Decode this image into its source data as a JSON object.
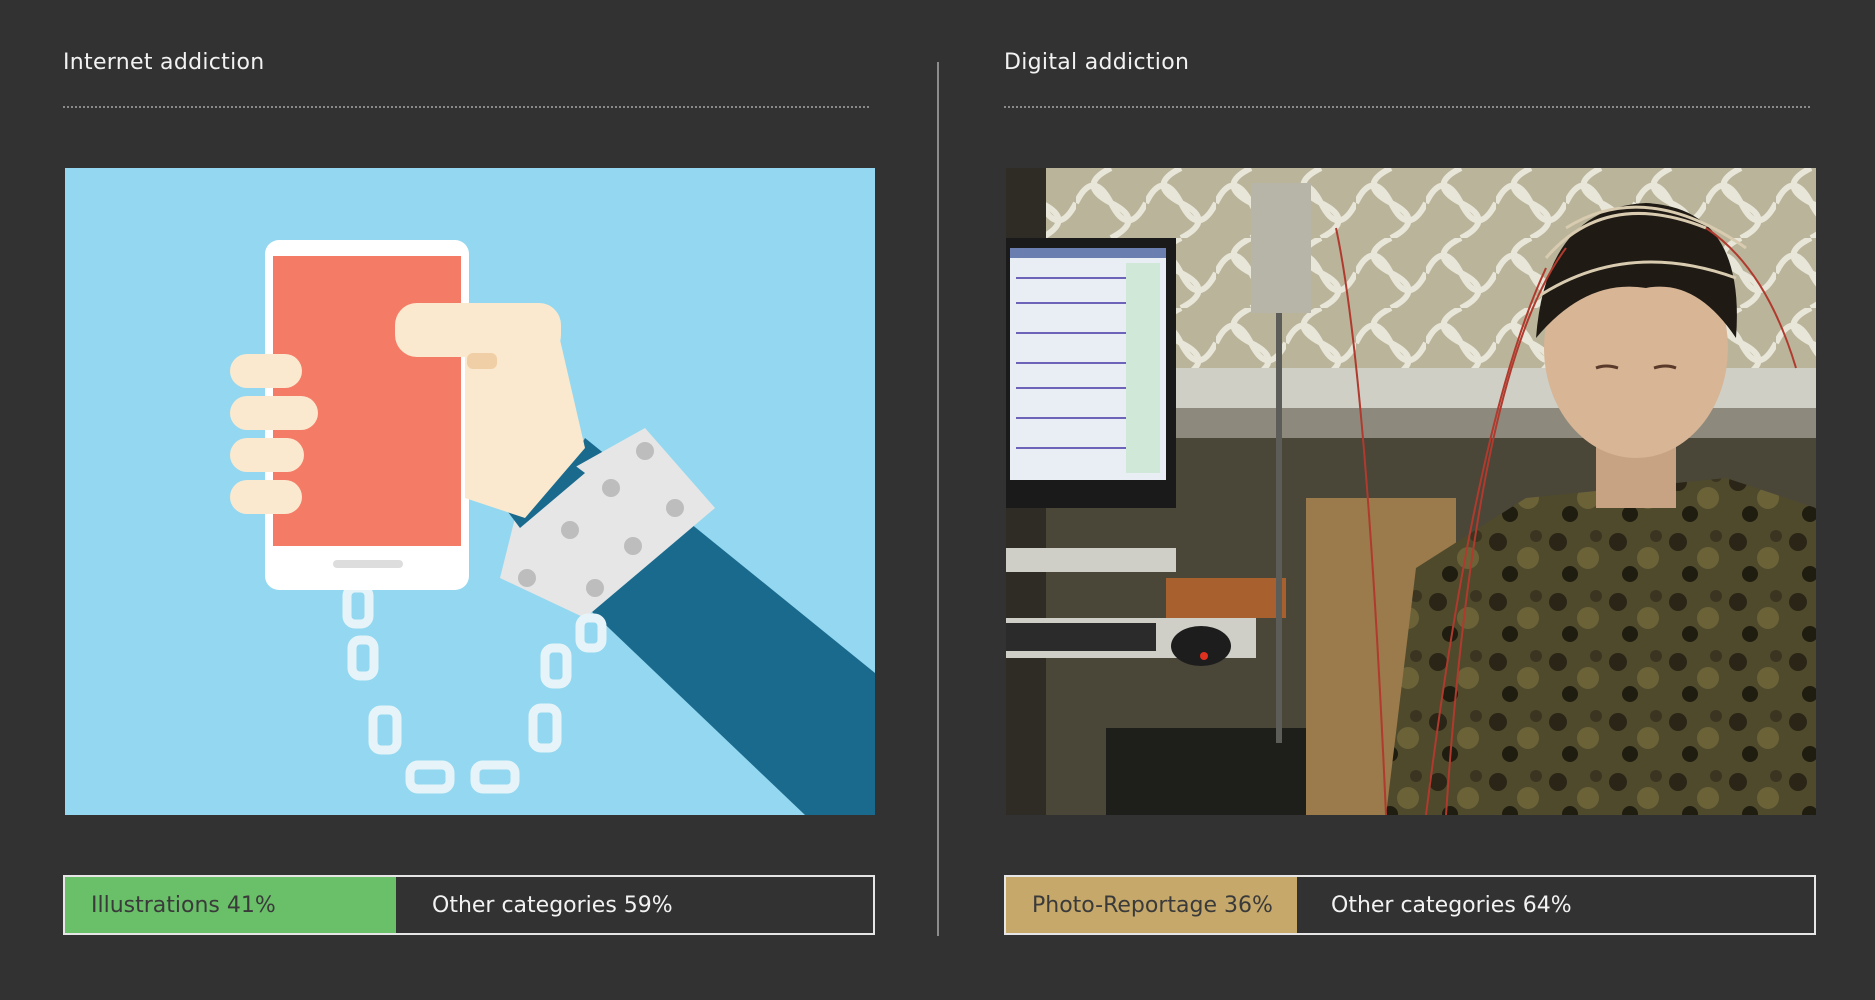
{
  "left_panel": {
    "title": "Internet addiction",
    "image_subject": "illustration-phone-chained-to-hand",
    "bar": {
      "category_label": "Illustrations 41%",
      "category_fraction": 0.41,
      "category_color": "#6abf69",
      "other_label": "Other categories 59%",
      "other_fraction": 0.59
    }
  },
  "right_panel": {
    "title": "Digital addiction",
    "image_subject": "photo-person-wearing-eeg-electrode-cap",
    "bar": {
      "category_label": "Photo-Reportage 36%",
      "category_fraction": 0.36,
      "category_color": "#c5a86a",
      "other_label": "Other categories 64%",
      "other_fraction": 0.64
    }
  },
  "colors": {
    "background": "#323232",
    "illustration_sky": "#93d8f0",
    "phone_screen": "#f47b66",
    "sleeve": "#1a6a8e"
  }
}
